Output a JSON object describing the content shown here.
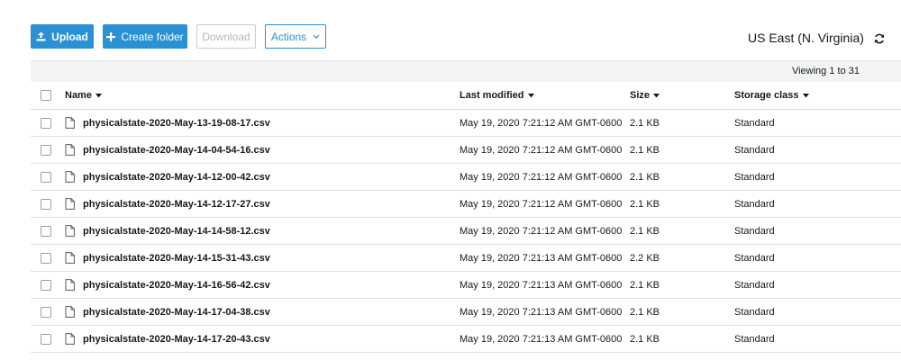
{
  "toolbar": {
    "upload_label": "Upload",
    "create_folder_label": "Create folder",
    "download_label": "Download",
    "actions_label": "Actions",
    "upload_icon": "upload-icon",
    "create_icon": "plus-icon",
    "actions_icon": "chevron-down-icon"
  },
  "region": {
    "label": "US East (N. Virginia)",
    "refresh_icon": "refresh-icon"
  },
  "pagination": {
    "viewing_text": "Viewing 1 to 31"
  },
  "table": {
    "columns": [
      {
        "label": "Name",
        "icon": "sort-down-icon"
      },
      {
        "label": "Last modified",
        "icon": "sort-down-icon"
      },
      {
        "label": "Size",
        "icon": "sort-down-icon"
      },
      {
        "label": "Storage class",
        "icon": "sort-down-icon"
      }
    ],
    "rows": [
      {
        "name": "physicalstate-2020-May-13-19-08-17.csv",
        "modified": "May 19, 2020 7:21:12 AM GMT-0600",
        "size": "2.1 KB",
        "class": "Standard"
      },
      {
        "name": "physicalstate-2020-May-14-04-54-16.csv",
        "modified": "May 19, 2020 7:21:12 AM GMT-0600",
        "size": "2.1 KB",
        "class": "Standard"
      },
      {
        "name": "physicalstate-2020-May-14-12-00-42.csv",
        "modified": "May 19, 2020 7:21:12 AM GMT-0600",
        "size": "2.1 KB",
        "class": "Standard"
      },
      {
        "name": "physicalstate-2020-May-14-12-17-27.csv",
        "modified": "May 19, 2020 7:21:12 AM GMT-0600",
        "size": "2.1 KB",
        "class": "Standard"
      },
      {
        "name": "physicalstate-2020-May-14-14-58-12.csv",
        "modified": "May 19, 2020 7:21:12 AM GMT-0600",
        "size": "2.1 KB",
        "class": "Standard"
      },
      {
        "name": "physicalstate-2020-May-14-15-31-43.csv",
        "modified": "May 19, 2020 7:21:13 AM GMT-0600",
        "size": "2.2 KB",
        "class": "Standard"
      },
      {
        "name": "physicalstate-2020-May-14-16-56-42.csv",
        "modified": "May 19, 2020 7:21:13 AM GMT-0600",
        "size": "2.1 KB",
        "class": "Standard"
      },
      {
        "name": "physicalstate-2020-May-14-17-04-38.csv",
        "modified": "May 19, 2020 7:21:13 AM GMT-0600",
        "size": "2.1 KB",
        "class": "Standard"
      },
      {
        "name": "physicalstate-2020-May-14-17-20-43.csv",
        "modified": "May 19, 2020 7:21:13 AM GMT-0600",
        "size": "2.1 KB",
        "class": "Standard"
      }
    ],
    "file_icon": "file-icon"
  },
  "colors": {
    "primary": "#2b91d5",
    "header_bg": "#f2f3f3",
    "text": "#16191f",
    "disabled_text": "#b4b7b9"
  }
}
